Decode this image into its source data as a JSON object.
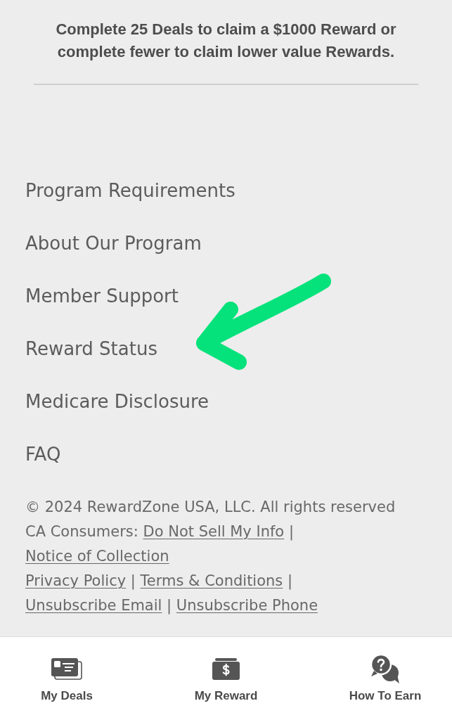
{
  "message": "Complete 25 Deals to claim a $1000 Reward or complete fewer to claim lower value Rewards.",
  "menu": [
    {
      "label": "Program Requirements"
    },
    {
      "label": "About Our Program"
    },
    {
      "label": "Member Support"
    },
    {
      "label": "Reward Status"
    },
    {
      "label": "Medicare Disclosure"
    },
    {
      "label": "FAQ"
    }
  ],
  "annotations": [
    {
      "kind": "arrow"
    }
  ],
  "legal": {
    "lines": [
      [
        {
          "kind": "text",
          "text": "© 2024 RewardZone USA, LLC. All rights reserved"
        }
      ],
      [
        {
          "kind": "text",
          "text": "CA Consumers:"
        },
        {
          "kind": "link",
          "text": "Do Not Sell My Info"
        },
        {
          "kind": "separator",
          "text": "|"
        },
        {
          "kind": "link",
          "text": "Notice of Collection"
        }
      ],
      [
        {
          "kind": "link",
          "text": "Privacy Policy"
        },
        {
          "kind": "separator",
          "text": "|"
        },
        {
          "kind": "link",
          "text": "Terms & Conditions"
        },
        {
          "kind": "separator",
          "text": "|"
        },
        {
          "kind": "link",
          "text": "Unsubscribe Email"
        },
        {
          "kind": "separator",
          "text": "|"
        },
        {
          "kind": "link",
          "text": "Unsubscribe Phone"
        }
      ]
    ]
  },
  "bottom_nav": [
    {
      "label": "My Deals"
    },
    {
      "label": "My Reward"
    },
    {
      "label": "How To Earn"
    }
  ]
}
